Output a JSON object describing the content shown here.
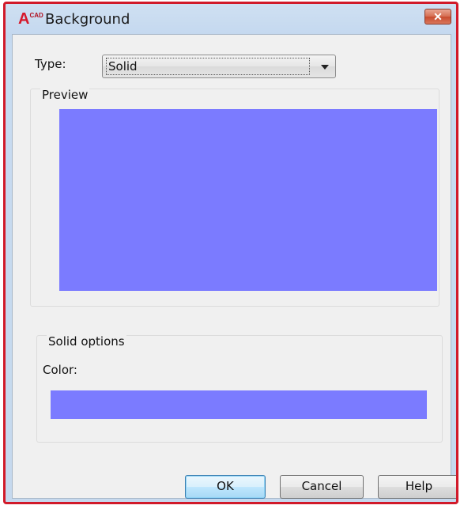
{
  "window": {
    "title": "Background",
    "app_icon_text": "A",
    "app_icon_superscript": "CAD",
    "close_symbol": "✕",
    "close_icon": "close-icon"
  },
  "type": {
    "label": "Type:",
    "selected": "Solid"
  },
  "preview": {
    "group_label": "Preview",
    "color": "#7b7bff"
  },
  "solid_options": {
    "group_label": "Solid options",
    "color_label": "Color:",
    "color": "#7b7bff"
  },
  "buttons": {
    "ok": "OK",
    "cancel": "Cancel",
    "help": "Help"
  },
  "colors": {
    "window_border": "#d11a2a",
    "swatch": "#7b7bff"
  }
}
